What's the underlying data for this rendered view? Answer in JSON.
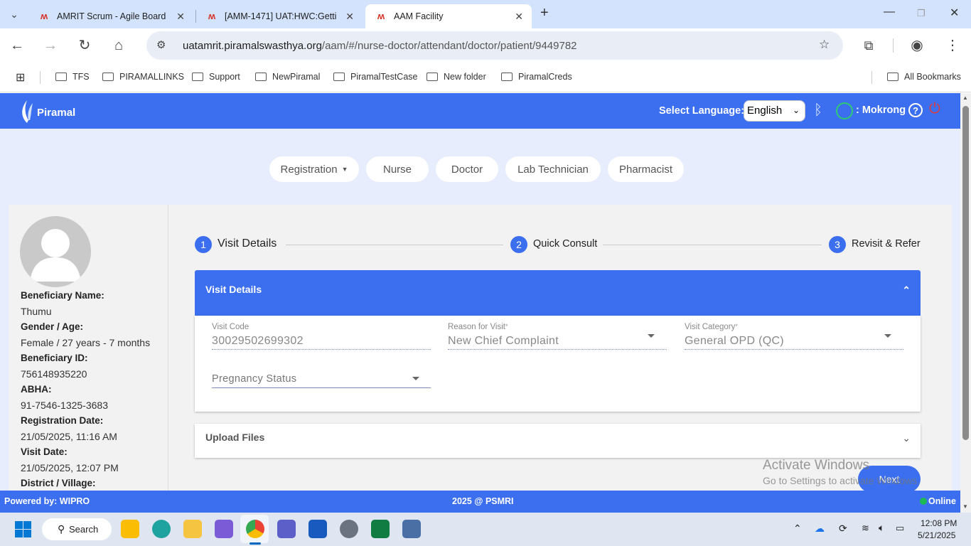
{
  "browser": {
    "tabs": [
      {
        "title": "AMRIT Scrum - Agile Board",
        "active": false
      },
      {
        "title": "[AMM-1471] UAT:HWC:Getti",
        "active": false
      },
      {
        "title": "AAM Facility",
        "active": true
      }
    ],
    "url_domain": "uatamrit.piramalswasthya.org",
    "url_path": "/aam/#/nurse-doctor/attendant/doctor/patient/9449782",
    "bookmarks": [
      "TFS",
      "PIRAMALLINKS",
      "Support",
      "NewPiramal",
      "PiramalTestCase",
      "New folder",
      "PiramalCreds"
    ],
    "all_bookmarks": "All Bookmarks"
  },
  "header": {
    "logo": "Piramal",
    "language_label": "Select Language:",
    "language_value": "English",
    "user": ": Mokrong"
  },
  "roles": [
    "Registration",
    "Nurse",
    "Doctor",
    "Lab Technician",
    "Pharmacist"
  ],
  "beneficiary": {
    "name_label": "Beneficiary Name:",
    "name": "Thumu",
    "gender_age_label": "Gender / Age:",
    "gender_age": "Female / 27 years - 7 months",
    "id_label": "Beneficiary ID:",
    "id": "756148935220",
    "abha_label": "ABHA:",
    "abha": "91-7546-1325-3683",
    "reg_date_label": "Registration Date:",
    "reg_date": "21/05/2025, 11:16 AM",
    "visit_date_label": "Visit Date:",
    "visit_date": "21/05/2025, 12:07 PM",
    "district_label": "District / Village:"
  },
  "steps": [
    {
      "num": "1",
      "label": "Visit Details"
    },
    {
      "num": "2",
      "label": "Quick Consult"
    },
    {
      "num": "3",
      "label": "Revisit & Refer"
    }
  ],
  "visit_details": {
    "title": "Visit Details",
    "visit_code_label": "Visit Code",
    "visit_code": "30029502699302",
    "reason_label": "Reason for Visit",
    "reason": "New Chief Complaint",
    "category_label": "Visit Category",
    "category": "General OPD (QC)",
    "pregnancy_label": "Pregnancy Status"
  },
  "upload": {
    "title": "Upload Files"
  },
  "next_label": "Next",
  "watermark": {
    "line1": "Activate Windows",
    "line2": "Go to Settings to activate Windows."
  },
  "footer": {
    "powered": "Powered by: WIPRO",
    "copyright": "2025 @ PSMRI",
    "status": "Online"
  },
  "taskbar": {
    "search": "Search",
    "time": "12:08 PM",
    "date": "5/21/2025"
  },
  "colors": {
    "primary": "#3b6ff0",
    "online": "#1db954"
  }
}
